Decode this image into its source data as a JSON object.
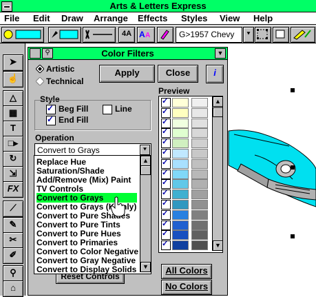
{
  "window": {
    "title": "Arts & Letters Express"
  },
  "menu": [
    "File",
    "Edit",
    "Draw",
    "Arrange",
    "Effects",
    "Styles",
    "View",
    "Help"
  ],
  "toolbar": {
    "symbol_name": "G>1957 Chevy"
  },
  "dialog": {
    "title": "Color Filters",
    "mode_artistic": "Artistic",
    "mode_technical": "Technical",
    "apply": "Apply",
    "close": "Close",
    "info": "i",
    "style_label": "Style",
    "beg_fill": "Beg Fill",
    "line": "Line",
    "end_fill": "End Fill",
    "operation_label": "Operation",
    "operation_value": "Convert to Grays",
    "operations": [
      "Replace Hue",
      "Saturation/Shade",
      "Add/Remove (Mix) Paint",
      "TV Controls",
      "Convert to Grays",
      "Convert to Grays (K only)",
      "Convert to Pure Shades",
      "Convert to Pure Tints",
      "Convert to Pure Hues",
      "Convert to Primaries",
      "Convert to Color Negative",
      "Convert to Gray Negative",
      "Convert to Display Solids"
    ],
    "selected_operation_index": 4,
    "reset": "Reset Controls",
    "preview_label": "Preview",
    "all_colors": "All Colors",
    "no_colors": "No Colors"
  },
  "colors": {
    "title_bar": "#00ff66",
    "selection": "#00ff33",
    "swatch_cyan": "#00ffff",
    "preview_left": [
      "#ffffd8",
      "#ffffc0",
      "#f0ffe0",
      "#e0ffd0",
      "#d0f0c0",
      "#c0e8ff",
      "#a8e0ff",
      "#80d8f8",
      "#60c8e8",
      "#40b0d0",
      "#3098c0",
      "#2880e0",
      "#2060d0",
      "#1850c0",
      "#1040a0"
    ],
    "preview_right": [
      "#f0f0f0",
      "#e8e8e8",
      "#e0e0e0",
      "#d8d8d8",
      "#d0d0d0",
      "#c8c8c8",
      "#c0c0c0",
      "#b8b8b8",
      "#b0b0b0",
      "#a0a0a0",
      "#909090",
      "#808080",
      "#707070",
      "#606060",
      "#505050"
    ]
  }
}
